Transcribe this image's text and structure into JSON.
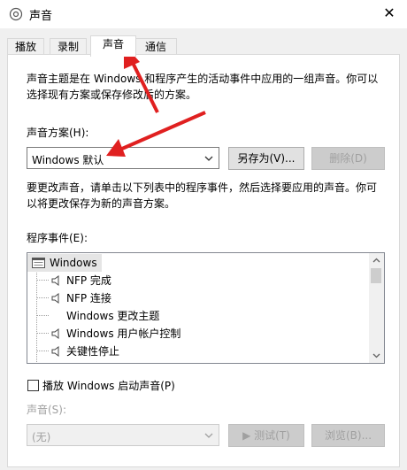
{
  "window": {
    "title": "声音",
    "close_symbol": "✕"
  },
  "tabs": [
    {
      "label": "播放"
    },
    {
      "label": "录制"
    },
    {
      "label": "声音",
      "active": true
    },
    {
      "label": "通信"
    }
  ],
  "intro_text_line1": "声音主题是在 Windows 和程序产生的活动事件中应用的一组声音。你可以",
  "intro_text_line2": "选择现有方案或保存修改后的方案。",
  "scheme": {
    "label": "声音方案(H):",
    "selected": "Windows 默认",
    "save_as_label": "另存为(V)...",
    "delete_label": "删除(D)"
  },
  "change_text_line1": "要更改声音，请单击以下列表中的程序事件，然后选择要应用的声音。你可",
  "change_text_line2": "以将更改保存为新的声音方案。",
  "events": {
    "label": "程序事件(E):",
    "items": [
      {
        "label": "Windows",
        "icon": "windows-app-icon",
        "level": 0
      },
      {
        "label": "NFP 完成",
        "icon": "speaker-icon",
        "level": 1
      },
      {
        "label": "NFP 连接",
        "icon": "speaker-icon",
        "level": 1
      },
      {
        "label": "Windows 更改主题",
        "icon": "",
        "level": 1
      },
      {
        "label": "Windows 用户帐户控制",
        "icon": "speaker-icon",
        "level": 1
      },
      {
        "label": "关键性停止",
        "icon": "speaker-icon",
        "level": 1
      }
    ]
  },
  "startup_checkbox_label": "播放 Windows 启动声音(P)",
  "sound": {
    "label": "声音(S):",
    "selected": "(无)",
    "test_label": "▶ 测试(T)",
    "browse_label": "浏览(B)..."
  },
  "colors": {
    "annotation_arrow": "#e02020",
    "selection_highlight": "#e5e5e5"
  }
}
